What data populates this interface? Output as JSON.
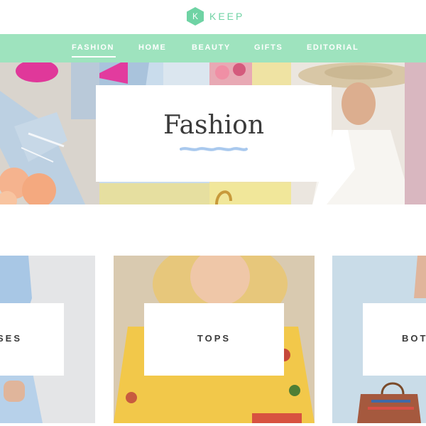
{
  "brand": {
    "logo_letter": "K",
    "logo_word": "KEEP",
    "accent": "#9ee3be",
    "logo_color": "#6fd3a4"
  },
  "nav": {
    "items": [
      {
        "label": "FASHION",
        "active": true
      },
      {
        "label": "HOME"
      },
      {
        "label": "BEAUTY"
      },
      {
        "label": "GIFTS"
      },
      {
        "label": "EDITORIAL"
      }
    ]
  },
  "hero": {
    "title": "Fashion",
    "squiggle_color": "#a9c9ee"
  },
  "categories": [
    {
      "label": "SES"
    },
    {
      "label": "TOPS"
    },
    {
      "label": "BOT"
    }
  ]
}
